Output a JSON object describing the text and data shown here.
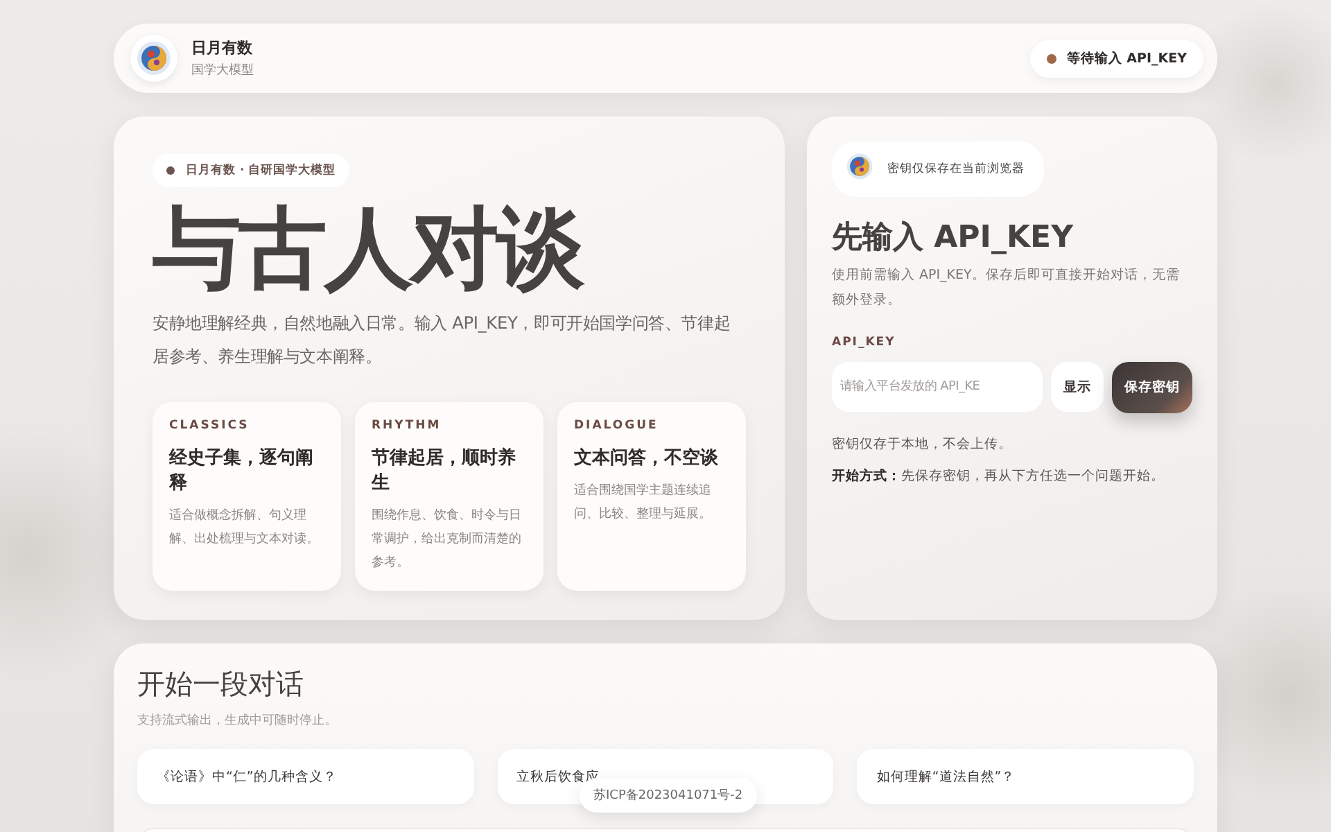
{
  "brand": {
    "name": "日月有数",
    "subtitle": "国学大模型"
  },
  "status": {
    "label": "等待输入 API_KEY",
    "color": "#a0674b"
  },
  "hero": {
    "badge": "日月有数 · 自研国学大模型",
    "title": "与古人对谈",
    "description": "安静地理解经典，自然地融入日常。输入 API_KEY，即可开始国学问答、节律起居参考、养生理解与文本阐释。",
    "features": [
      {
        "tag": "CLASSICS",
        "title": "经史子集，逐句阐释",
        "text": "适合做概念拆解、句义理解、出处梳理与文本对读。"
      },
      {
        "tag": "RHYTHM",
        "title": "节律起居，顺时养生",
        "text": "围绕作息、饮食、时令与日常调护，给出克制而清楚的参考。"
      },
      {
        "tag": "DIALOGUE",
        "title": "文本问答，不空谈",
        "text": "适合围绕国学主题连续追问、比较、整理与延展。"
      }
    ]
  },
  "key_panel": {
    "notice": "密钥仅保存在当前浏览器",
    "title": "先输入 API_KEY",
    "description": "使用前需输入 API_KEY。保存后即可直接开始对话，无需额外登录。",
    "field_label": "API_KEY",
    "placeholder": "请输入平台发放的 API_KE",
    "show_button": "显示",
    "save_button": "保存密钥",
    "note": "密钥仅存于本地，不会上传。",
    "howto": "**开始方式：**先保存密钥，再从下方任选一个问题开始。"
  },
  "conversation": {
    "title": "开始一段对话",
    "subtitle": "支持流式输出，生成中可随时停止。",
    "suggestions": [
      "《论语》中“仁”的几种含义？",
      "立秋后饮食应",
      "如何理解“道法自然”？"
    ]
  },
  "footer_badge": "苏ICP备2023041071号-2"
}
